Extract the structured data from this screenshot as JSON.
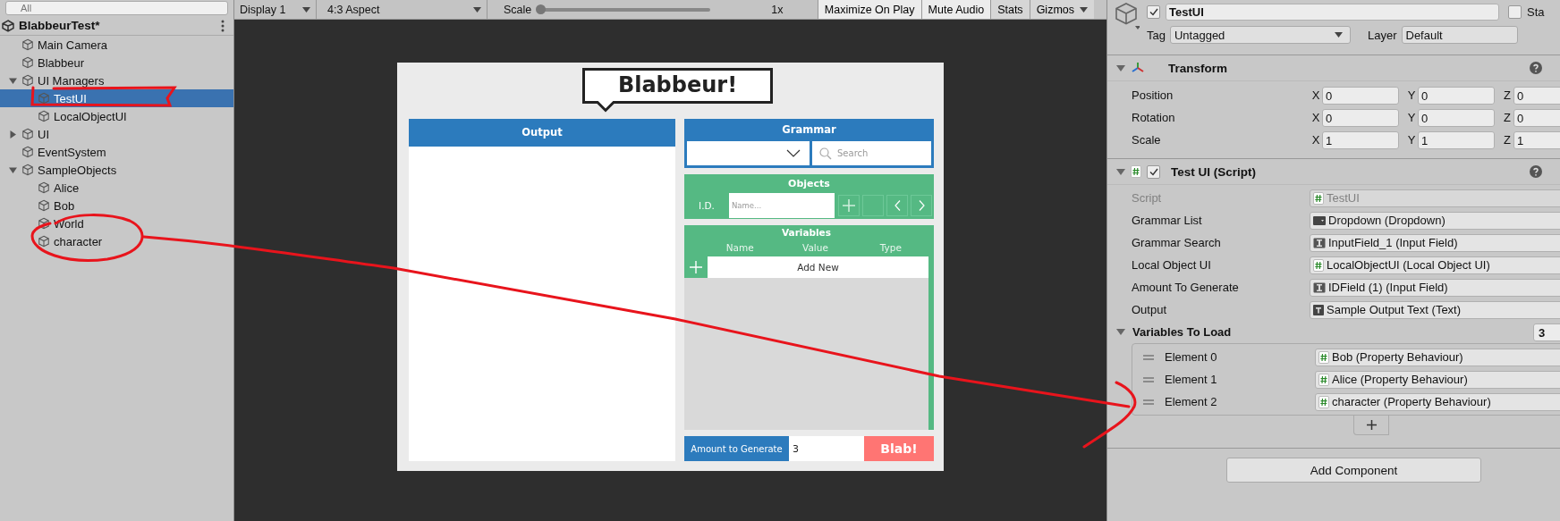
{
  "hierarchy": {
    "search": {
      "placeholder": "All"
    },
    "scene": "BlabbeurTest*",
    "items": [
      {
        "label": "Main Camera",
        "selected": false
      },
      {
        "label": "Blabbeur",
        "selected": false
      },
      {
        "label": "UI Managers",
        "selected": false,
        "expanded": true,
        "children": [
          {
            "label": "TestUI",
            "selected": true
          },
          {
            "label": "LocalObjectUI",
            "selected": false
          }
        ]
      },
      {
        "label": "UI",
        "selected": false,
        "expanded": false
      },
      {
        "label": "EventSystem",
        "selected": false
      },
      {
        "label": "SampleObjects",
        "selected": false,
        "expanded": true,
        "children": [
          {
            "label": "Alice",
            "selected": false
          },
          {
            "label": "Bob",
            "selected": false
          },
          {
            "label": "World",
            "selected": false
          },
          {
            "label": "character",
            "selected": false
          }
        ]
      }
    ]
  },
  "game_toolbar": {
    "display": "Display 1",
    "aspect": "4:3 Aspect",
    "scale_label": "Scale",
    "scale": {
      "level": 0
    },
    "scale_value": "1x",
    "buttons": [
      "Maximize On Play",
      "Mute Audio",
      "Stats",
      "Gizmos"
    ]
  },
  "game_ui": {
    "title": "Blabbeur!",
    "output": {
      "header": "Output"
    },
    "grammar": {
      "header": "Grammar",
      "search_placeholder": "Search"
    },
    "objects": {
      "header": "Objects",
      "id_label": "I.D.",
      "name_placeholder": "Name..."
    },
    "variables": {
      "header": "Variables",
      "columns": [
        "Name",
        "Value",
        "Type"
      ],
      "add_new": "Add New"
    },
    "amount": {
      "label": "Amount to Generate",
      "value": "3"
    },
    "blab_button": "Blab!"
  },
  "inspector": {
    "object": {
      "name": "TestUI",
      "active": true,
      "static": false,
      "static_label": "Sta",
      "tag_label": "Tag",
      "tag": "Untagged",
      "layer_label": "Layer",
      "layer": "Default"
    },
    "transform": {
      "title": "Transform",
      "rows": [
        {
          "label": "Position",
          "fields": [
            {
              "axis": "X",
              "value": "0"
            },
            {
              "axis": "Y",
              "value": "0"
            },
            {
              "axis": "Z",
              "value": "0"
            }
          ]
        },
        {
          "label": "Rotation",
          "fields": [
            {
              "axis": "X",
              "value": "0"
            },
            {
              "axis": "Y",
              "value": "0"
            },
            {
              "axis": "Z",
              "value": "0"
            }
          ]
        },
        {
          "label": "Scale",
          "fields": [
            {
              "axis": "X",
              "value": "1"
            },
            {
              "axis": "Y",
              "value": "1"
            },
            {
              "axis": "Z",
              "value": "1"
            }
          ]
        }
      ]
    },
    "component": {
      "title": "Test UI (Script)",
      "enabled": true,
      "fields": [
        {
          "label": "Script",
          "value": "TestUI",
          "kind": "script",
          "disabled": true
        },
        {
          "label": "Grammar List",
          "value": "Dropdown (Dropdown)",
          "kind": "dropdown",
          "disabled": false
        },
        {
          "label": "Grammar Search",
          "value": "InputField_1 (Input Field)",
          "kind": "input",
          "disabled": false
        },
        {
          "label": "Local Object UI",
          "value": "LocalObjectUI (Local Object UI)",
          "kind": "script",
          "disabled": false
        },
        {
          "label": "Amount To Generate",
          "value": "IDField (1) (Input Field)",
          "kind": "input",
          "disabled": false
        },
        {
          "label": "Output",
          "value": "Sample Output Text (Text)",
          "kind": "text",
          "disabled": false
        }
      ],
      "list": {
        "label": "Variables To Load",
        "count": "3",
        "elements": [
          {
            "label": "Element 0",
            "value": "Bob (Property Behaviour)"
          },
          {
            "label": "Element 1",
            "value": "Alice (Property Behaviour)"
          },
          {
            "label": "Element 2",
            "value": "character (Property Behaviour)"
          }
        ]
      }
    },
    "add_component": "Add Component"
  }
}
